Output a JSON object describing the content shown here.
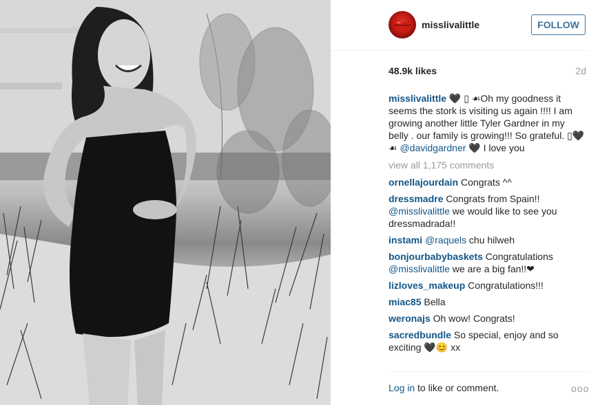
{
  "post": {
    "username": "misslivalittle",
    "follow_label": "FOLLOW",
    "likes": "48.9k likes",
    "age": "2d",
    "caption": {
      "author": "misslivalittle",
      "text_a": " 🖤 ▯ ☙Oh my goodness it seems the stork is visiting us again !!!! I am growing another little Tyler Gardner in my belly . our family is growing!!! So grateful. ▯🖤☙ ",
      "mention": "@davidgardner",
      "text_b": " 🖤 I love you"
    },
    "view_all": "view all 1,175 comments",
    "comments": [
      {
        "user": "ornellajourdain",
        "pre": " Congrats ^^",
        "mention": "",
        "post": ""
      },
      {
        "user": "dressmadre",
        "pre": " Congrats from Spain!! ",
        "mention": "@misslivalittle",
        "post": " we would like to see you dressmadrada!!"
      },
      {
        "user": "instami",
        "pre": " ",
        "mention": "@raquels",
        "post": " chu hilweh"
      },
      {
        "user": "bonjourbabybaskets",
        "pre": " Congratulations ",
        "mention": "@misslivalittle",
        "post": " we are a big fan!!❤"
      },
      {
        "user": "lizloves_makeup",
        "pre": " Congratulations!!!",
        "mention": "",
        "post": ""
      },
      {
        "user": "miac85",
        "pre": " Bella",
        "mention": "",
        "post": ""
      },
      {
        "user": "weronajs",
        "pre": " Oh wow! Congrats!",
        "mention": "",
        "post": ""
      },
      {
        "user": "sacredbundle",
        "pre": " So special, enjoy and so exciting 🖤😊 xx",
        "mention": "",
        "post": ""
      }
    ],
    "footer": {
      "login_link": "Log in",
      "login_rest": " to like or comment.",
      "more": "ooo"
    }
  },
  "colors": {
    "link": "#125688",
    "follow_border": "#3f729b",
    "muted": "#999999"
  },
  "icons": {
    "avatar": "red-lips-avatar",
    "more": "more-options-icon"
  }
}
